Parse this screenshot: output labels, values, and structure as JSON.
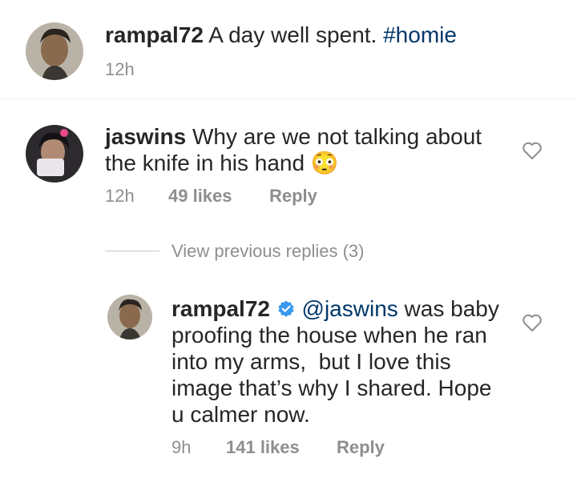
{
  "caption": {
    "username": "rampal72",
    "text": "A day well spent.",
    "hashtag": "#homie",
    "time": "12h"
  },
  "comment": {
    "username": "jaswins",
    "line1": "Why are we not talking about",
    "line2": "the knife in his hand",
    "emoji": "😳",
    "time": "12h",
    "likes": "49 likes",
    "reply_label": "Reply"
  },
  "view_previous": "View previous replies (3)",
  "reply": {
    "username": "rampal72",
    "mention": "@jaswins",
    "line1_rest": "was baby",
    "line2": "proofing the house when he ran",
    "line3": "into my arms,  but I love this",
    "line4": "image that’s why I shared. Hope",
    "line5": "u calmer now.",
    "time": "9h",
    "likes": "141 likes",
    "reply_label": "Reply"
  },
  "colors": {
    "link": "#00376b",
    "meta": "#8e8e8e",
    "verified": "#3897f0"
  }
}
